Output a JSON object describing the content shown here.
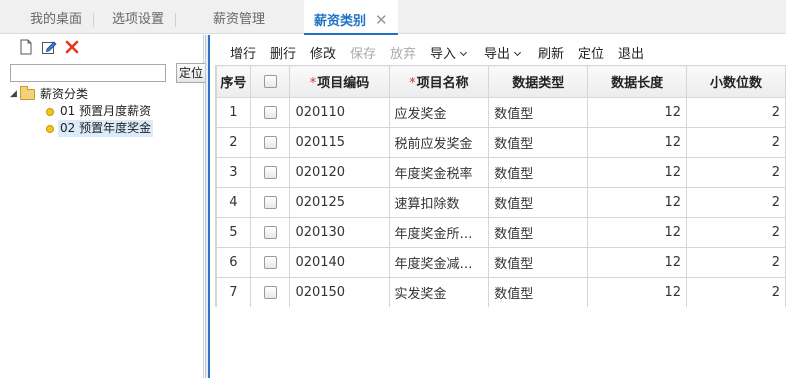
{
  "tabs": [
    {
      "label": "我的桌面"
    },
    {
      "label": "选项设置"
    },
    {
      "label": "薪资管理"
    },
    {
      "label": "薪资类别",
      "active": true
    }
  ],
  "left": {
    "tools": [
      "new-icon",
      "edit-icon",
      "delete-icon"
    ],
    "search": {
      "value": "",
      "placeholder": ""
    },
    "locate_label": "定位",
    "tree": {
      "root": "薪资分类",
      "children": [
        {
          "label": "01 预置月度薪资"
        },
        {
          "label": "02 预置年度奖金",
          "selected": true
        }
      ]
    }
  },
  "toolbar": {
    "add_row": "增行",
    "delete_row": "删行",
    "modify": "修改",
    "save": "保存",
    "discard": "放弃",
    "import": "导入",
    "export": "导出",
    "refresh": "刷新",
    "locate": "定位",
    "exit": "退出"
  },
  "grid": {
    "columns": {
      "seq": "序号",
      "code": "项目编码",
      "name": "项目名称",
      "type": "数据类型",
      "length": "数据长度",
      "decimals": "小数位数"
    },
    "rows": [
      {
        "seq": "1",
        "code": "020110",
        "name": "应发奖金",
        "type": "数值型",
        "length": "12",
        "decimals": "2"
      },
      {
        "seq": "2",
        "code": "020115",
        "name": "税前应发奖金",
        "type": "数值型",
        "length": "12",
        "decimals": "2"
      },
      {
        "seq": "3",
        "code": "020120",
        "name": "年度奖金税率",
        "type": "数值型",
        "length": "12",
        "decimals": "2"
      },
      {
        "seq": "4",
        "code": "020125",
        "name": "速算扣除数",
        "type": "数值型",
        "length": "12",
        "decimals": "2"
      },
      {
        "seq": "5",
        "code": "020130",
        "name": "年度奖金所…",
        "type": "数值型",
        "length": "12",
        "decimals": "2"
      },
      {
        "seq": "6",
        "code": "020140",
        "name": "年度奖金减…",
        "type": "数值型",
        "length": "12",
        "decimals": "2"
      },
      {
        "seq": "7",
        "code": "020150",
        "name": "实发奖金",
        "type": "数值型",
        "length": "12",
        "decimals": "2"
      }
    ]
  },
  "colors": {
    "accent": "#1f73c6",
    "required": "#e03131",
    "splitter": "#2f73c4"
  }
}
